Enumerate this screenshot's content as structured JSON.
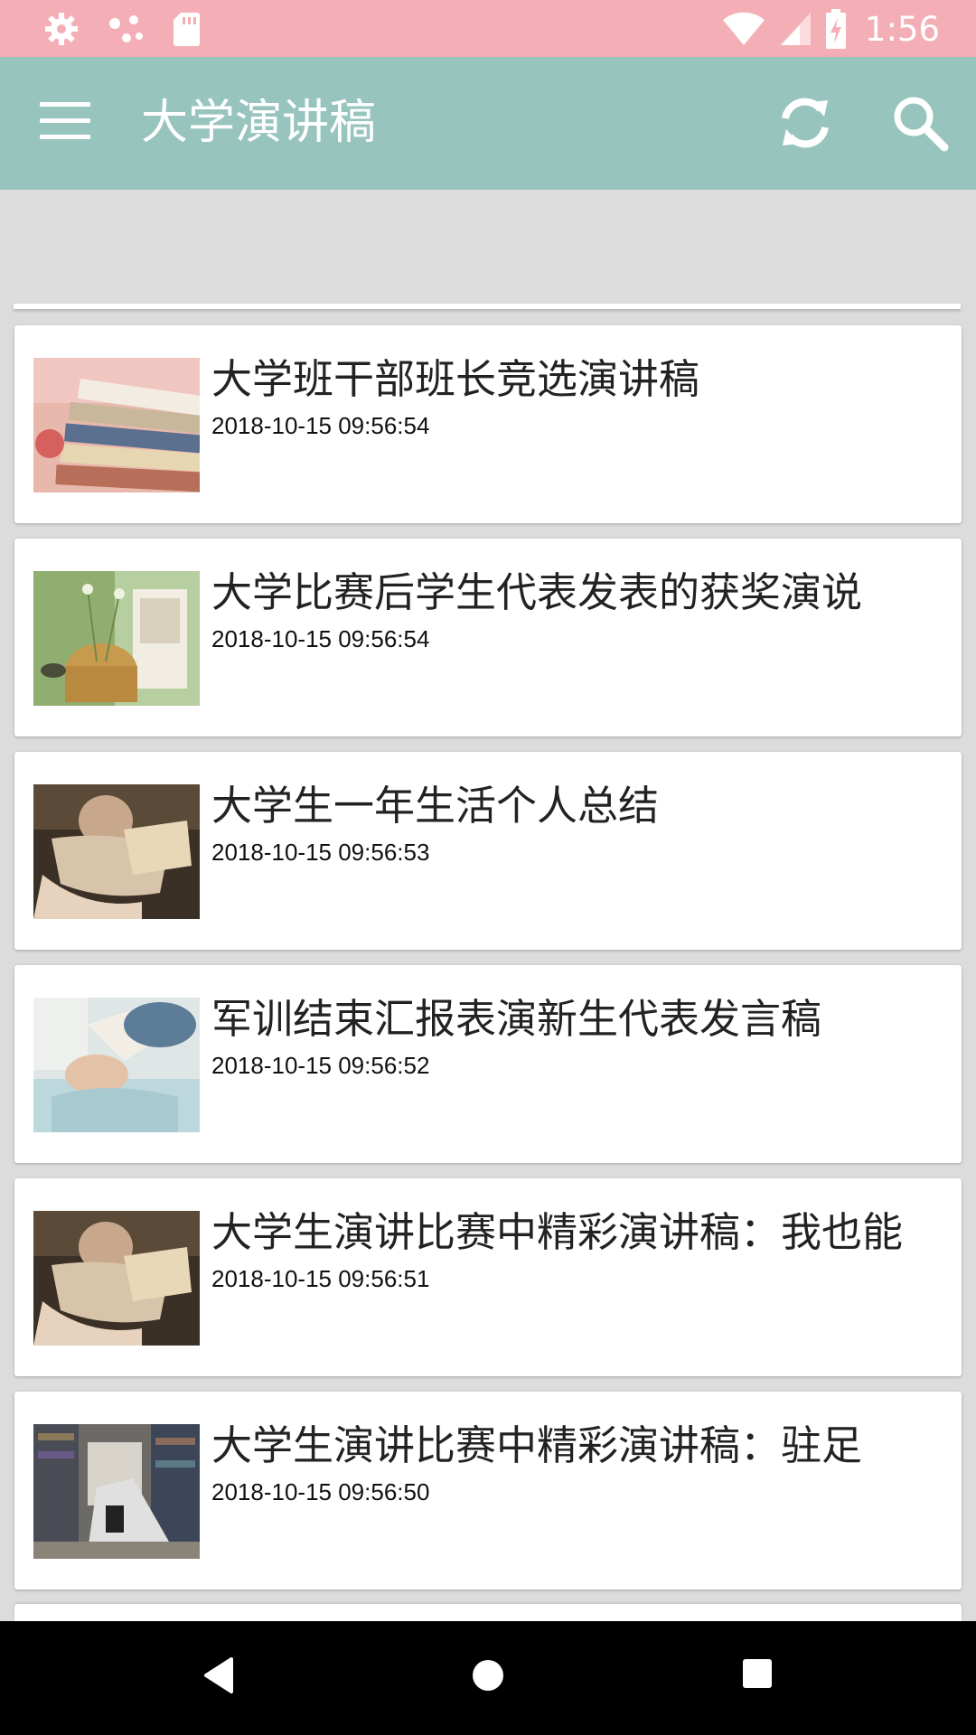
{
  "status_bar": {
    "time": "1:56",
    "left_icons": [
      "settings-icon",
      "dots-icon",
      "sd-card-icon"
    ],
    "right_icons": [
      "wifi-icon",
      "signal-icon",
      "battery-charging-icon"
    ]
  },
  "app_bar": {
    "title": "大学演讲稿",
    "menu_icon": "menu-icon",
    "actions": [
      "refresh-icon",
      "search-icon"
    ],
    "background": "#98c4be"
  },
  "articles": [
    {
      "title": "大学班干部班长竞选演讲稿",
      "time": "2018-10-15 09:56:54",
      "thumb": "books-stack"
    },
    {
      "title": "大学比赛后学生代表发表的获奖演说",
      "time": "2018-10-15 09:56:54",
      "thumb": "flowers-book"
    },
    {
      "title": "大学生一年生活个人总结",
      "time": "2018-10-15 09:56:53",
      "thumb": "girl-reading-chair"
    },
    {
      "title": "军训结束汇报表演新生代表发言稿",
      "time": "2018-10-15 09:56:52",
      "thumb": "girl-book-face"
    },
    {
      "title": "大学生演讲比赛中精彩演讲稿：我也能",
      "time": "2018-10-15 09:56:51",
      "thumb": "girl-reading-chair"
    },
    {
      "title": "大学生演讲比赛中精彩演讲稿：驻足",
      "time": "2018-10-15 09:56:50",
      "thumb": "girl-library"
    }
  ],
  "nav_bar": {
    "buttons": [
      "back-icon",
      "home-icon",
      "recents-icon"
    ]
  },
  "colors": {
    "status_bar": "#f4afb6",
    "app_bar": "#98c4be",
    "background": "#dcdcdc"
  }
}
